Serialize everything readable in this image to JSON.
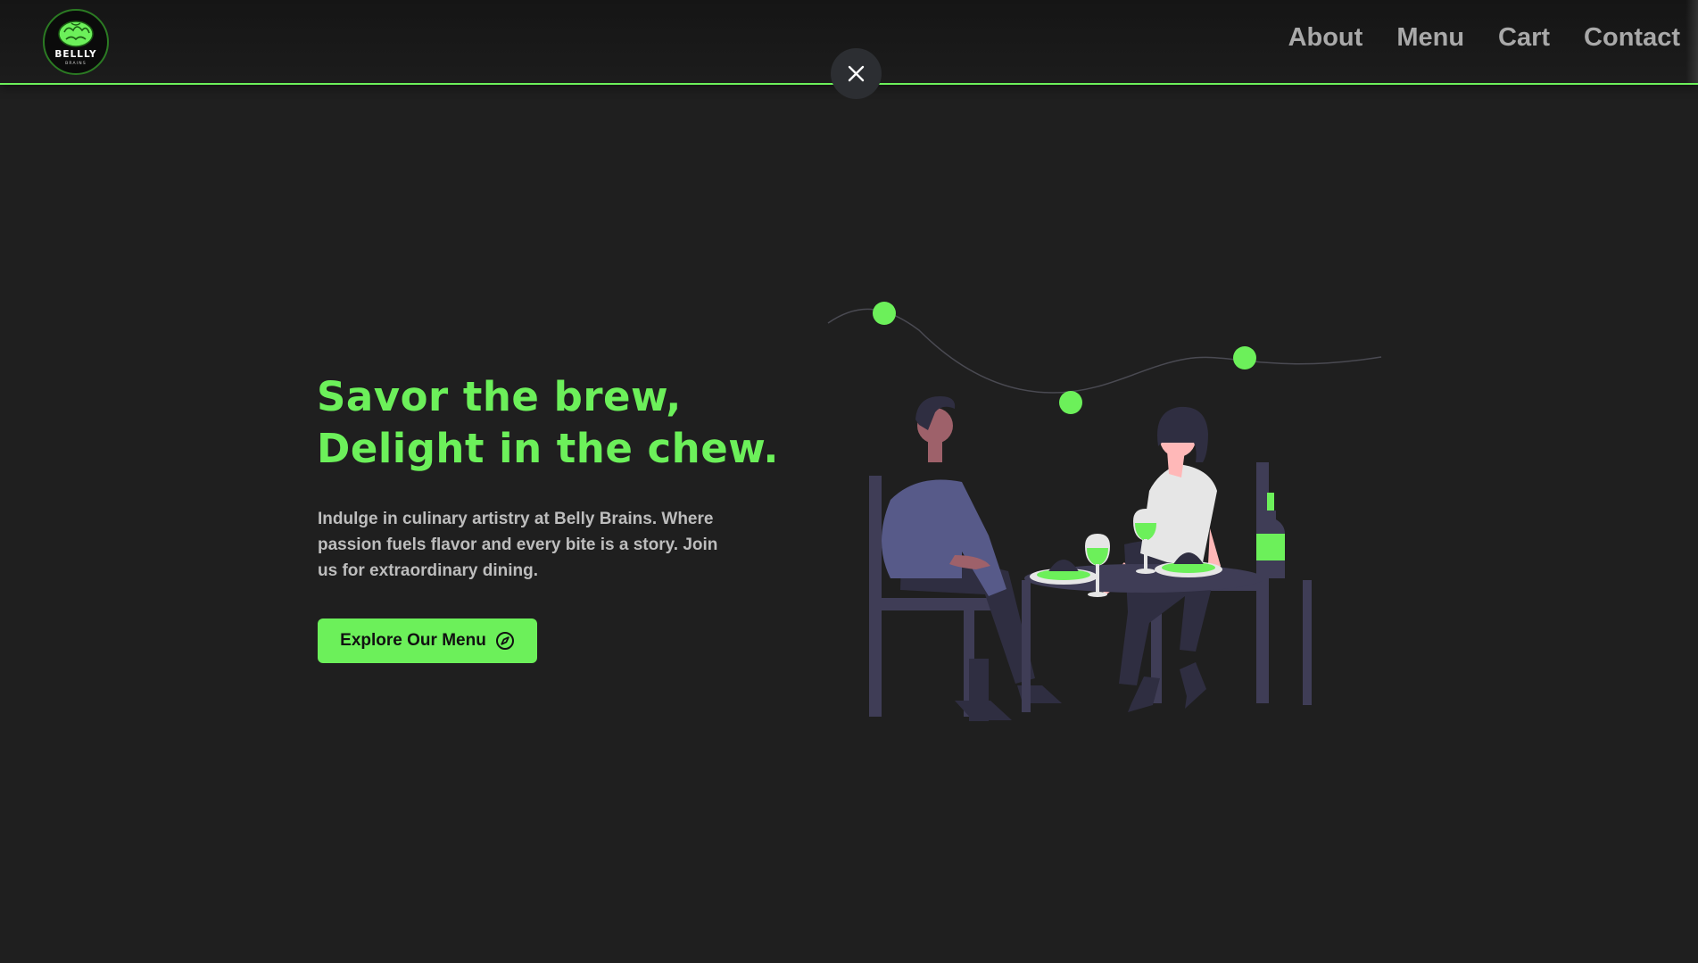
{
  "header": {
    "logo": {
      "brand": "BELLLY",
      "subtext": "BRAINS"
    },
    "nav": [
      {
        "label": "About"
      },
      {
        "label": "Menu"
      },
      {
        "label": "Cart"
      },
      {
        "label": "Contact"
      }
    ]
  },
  "overlay": {
    "close_icon": "close-icon"
  },
  "hero": {
    "title_line1": "Savor the brew,",
    "title_line2": "Delight in the chew.",
    "description": "Indulge in culinary artistry at Belly Brains. Where passion fuels flavor and every bite is a story. Join us for extraordinary dining.",
    "cta_label": "Explore Our Menu",
    "cta_icon": "compass-icon"
  },
  "colors": {
    "accent": "#6cf05a",
    "background": "#1f1f1f",
    "nav_text": "#a9a9a9"
  }
}
